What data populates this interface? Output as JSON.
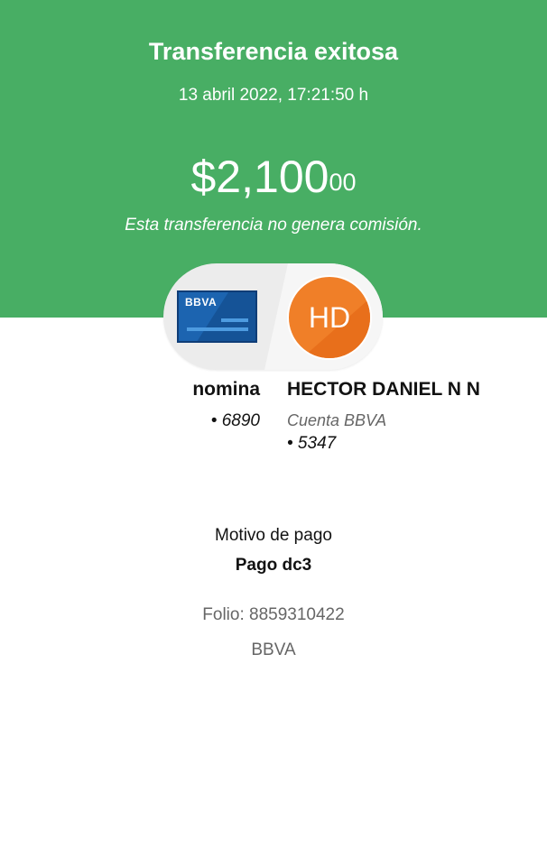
{
  "header": {
    "title": "Transferencia exitosa",
    "datetime": "13 abril 2022, 17:21:50 h",
    "amount_main": "$2,100",
    "amount_cents": "00",
    "commission_note": "Esta transferencia no genera comisión.",
    "background_color": "#48ae64"
  },
  "origin": {
    "card_brand": "BBVA",
    "name": "nomina",
    "account": "• 6890"
  },
  "destination": {
    "initials": "HD",
    "avatar_color": "#f07f28",
    "name": "HECTOR DANIEL N N",
    "bank": "Cuenta BBVA",
    "account": "• 5347"
  },
  "details": {
    "motive_label": "Motivo de pago",
    "motive_value": "Pago dc3",
    "folio": "Folio: 8859310422",
    "bank": "BBVA"
  }
}
